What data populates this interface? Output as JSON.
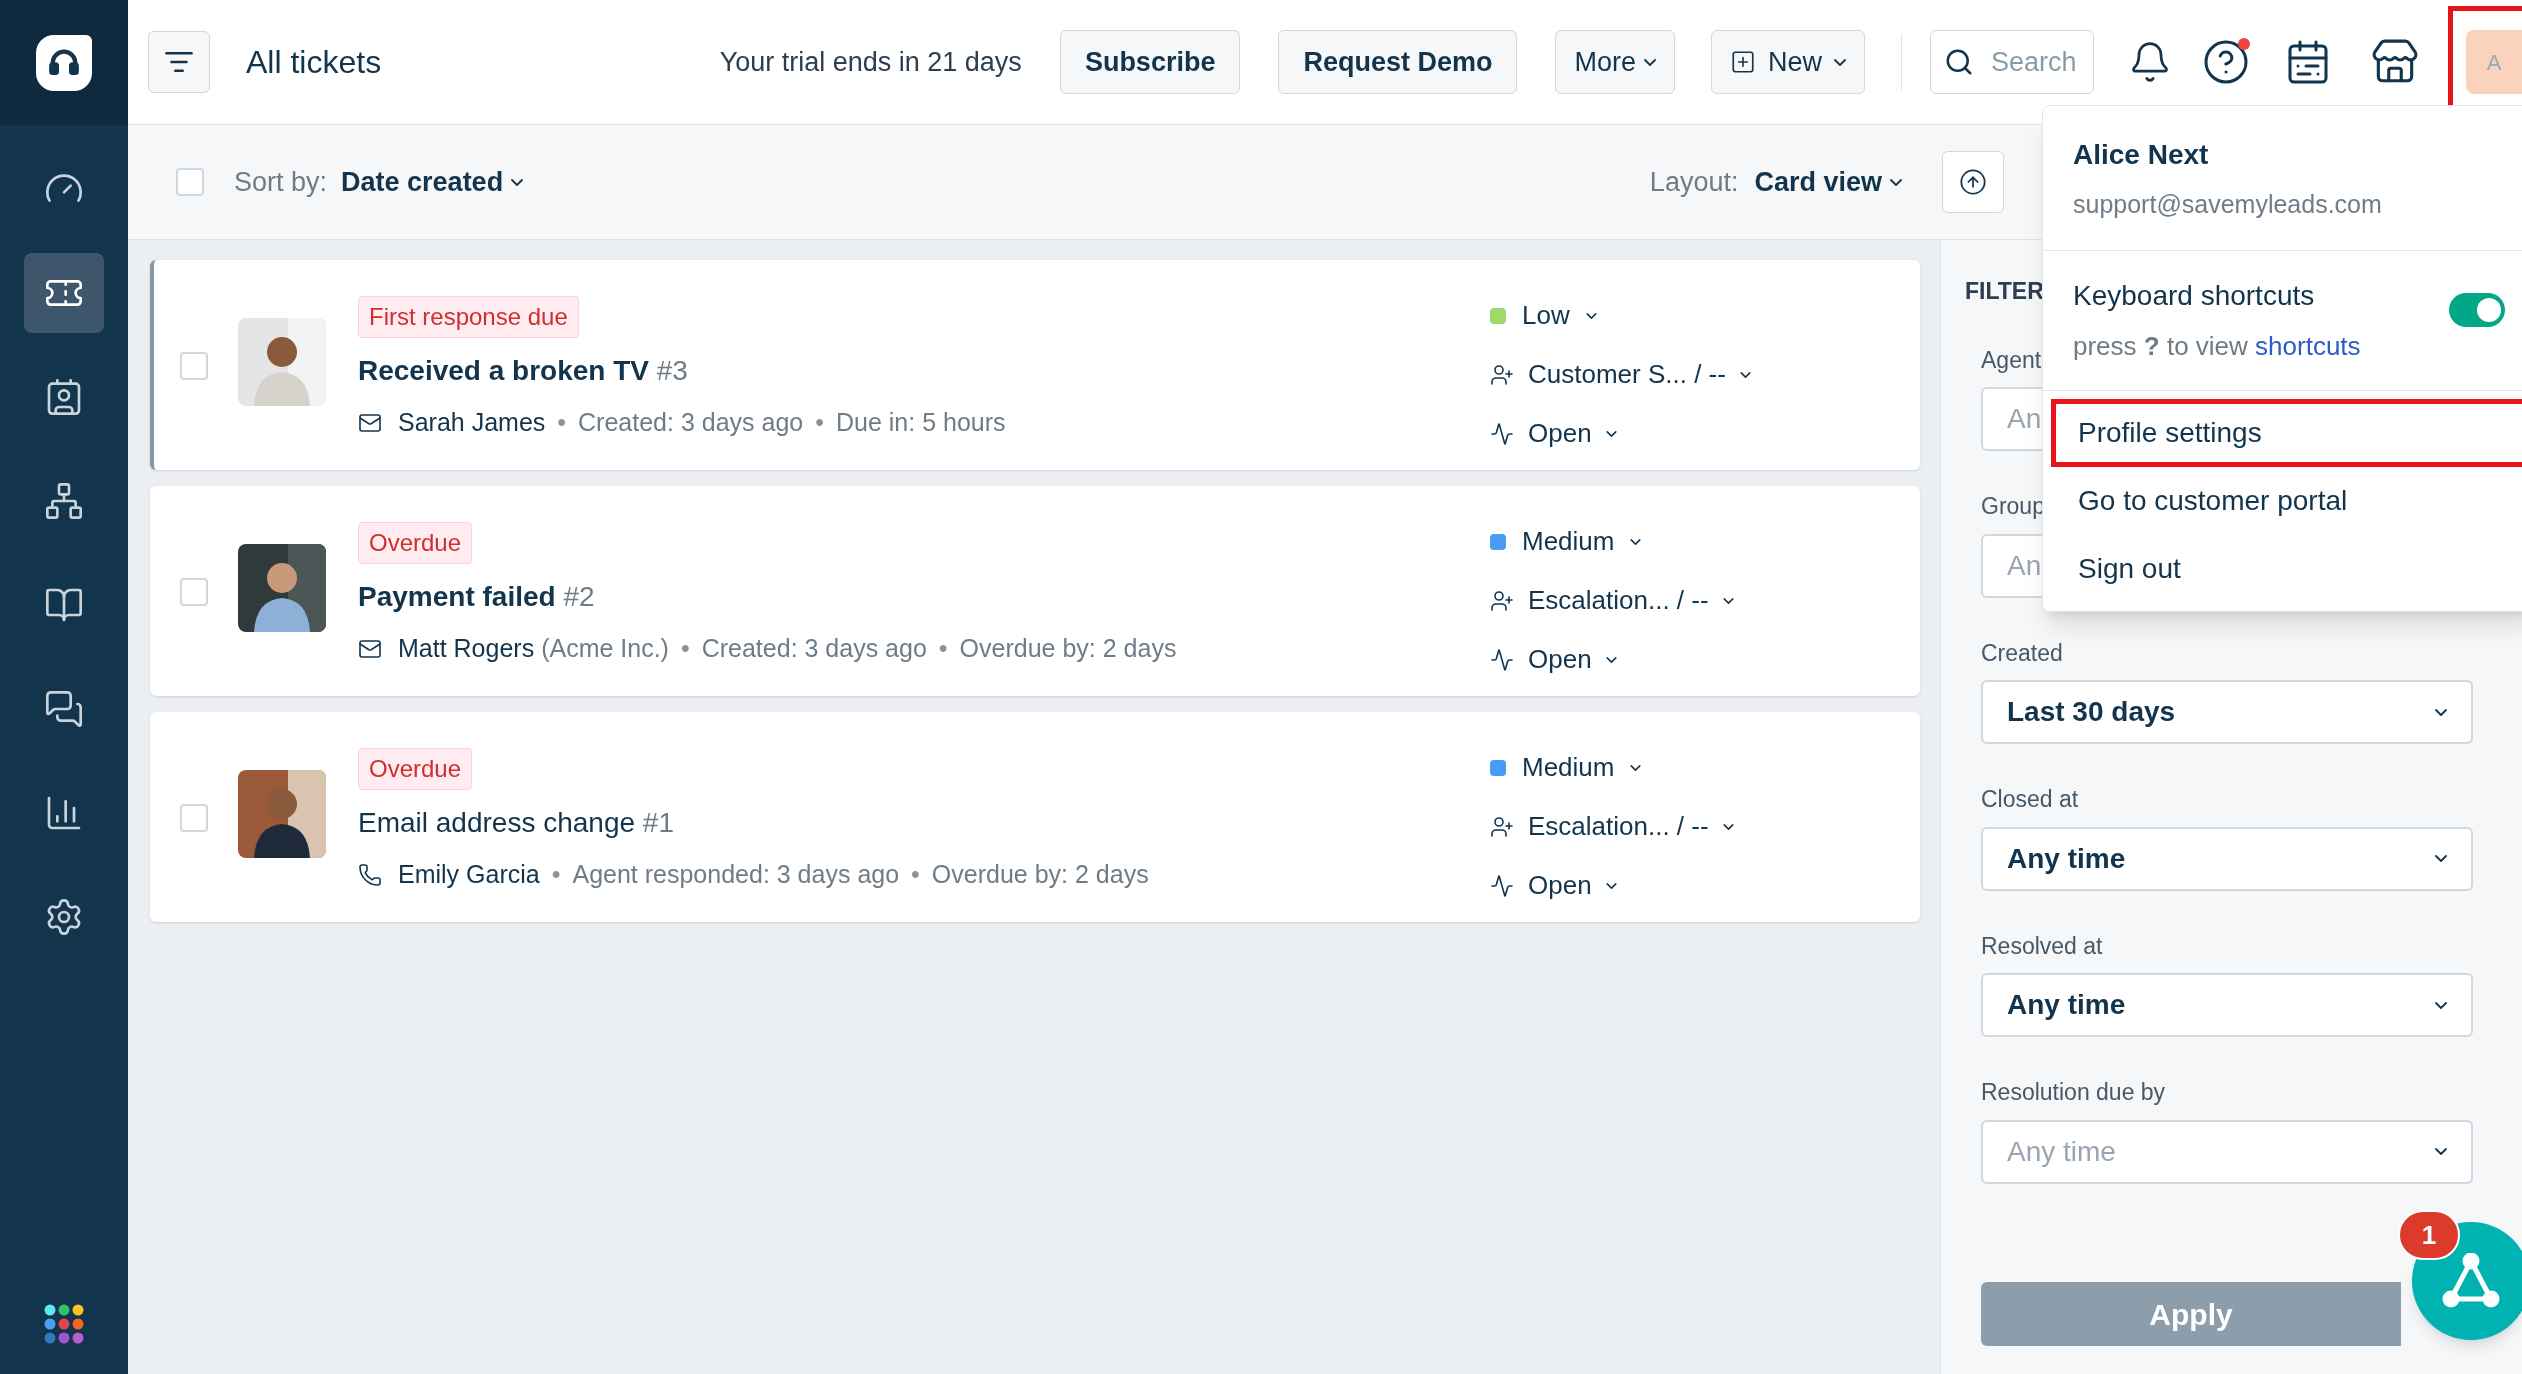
{
  "sidebar": {
    "items": [
      {
        "kind": "dashboard",
        "selected": false
      },
      {
        "kind": "tickets",
        "selected": true
      },
      {
        "kind": "contacts",
        "selected": false
      },
      {
        "kind": "groups",
        "selected": false
      },
      {
        "kind": "knowledge",
        "selected": false
      },
      {
        "kind": "conversations",
        "selected": false
      },
      {
        "kind": "reports",
        "selected": false
      },
      {
        "kind": "settings",
        "selected": false
      }
    ]
  },
  "header": {
    "title": "All tickets",
    "trial_notice": "Your trial ends in 21 days",
    "buttons": [
      "Subscribe",
      "Request Demo"
    ],
    "more": "More",
    "new": "New",
    "search_placeholder": "Search",
    "help_alert": true,
    "avatar": {
      "initial": "A",
      "highlighted": true
    }
  },
  "toolbar": {
    "select_all_checked": false,
    "sort_label": "Sort by:",
    "sort_value": "Date created",
    "layout_label": "Layout:",
    "layout_value": "Card view"
  },
  "tickets": [
    {
      "selected": true,
      "unread": true,
      "tag": "First response due",
      "title": "Received a broken TV",
      "number": "#3",
      "kind": "email",
      "contact": "Sarah James",
      "meta": [
        {
          "sep": "•",
          "text": "Created: 3 days ago"
        },
        {
          "sep": "•",
          "text": "Due in: 5 hours"
        }
      ],
      "priority": "Low",
      "color": "#9fd96b",
      "group": "Customer S... / --",
      "status": "Open"
    },
    {
      "selected": false,
      "unread": true,
      "tag": "Overdue",
      "title": "Payment failed",
      "number": "#2",
      "kind": "email",
      "contact": "Matt Rogers",
      "company": "(Acme Inc.)",
      "meta": [
        {
          "sep": "•",
          "text": "Created: 3 days ago"
        },
        {
          "sep": "•",
          "text": "Overdue by: 2 days"
        }
      ],
      "priority": "Medium",
      "color": "#4a9bf5",
      "group": "Escalation... / --",
      "status": "Open"
    },
    {
      "selected": false,
      "unread": false,
      "tag": "Overdue",
      "title": "Email address change",
      "number": "#1",
      "kind": "phone",
      "contact": "Emily Garcia",
      "meta": [
        {
          "sep": "•",
          "text": "Agent responded: 3 days ago"
        },
        {
          "sep": "•",
          "text": "Overdue by: 2 days"
        }
      ],
      "priority": "Medium",
      "color": "#4a9bf5",
      "group": "Escalation... / --",
      "status": "Open"
    }
  ],
  "filters": {
    "title": "FILTER",
    "fields": [
      {
        "label": "Agent",
        "placeholder": "An",
        "kind": "partial"
      },
      {
        "label": "Group",
        "placeholder": "An",
        "kind": "partial"
      },
      {
        "label": "Created",
        "value": "Last 30 days"
      },
      {
        "label": "Closed at",
        "value": "Any time"
      },
      {
        "label": "Resolved at",
        "value": "Any time"
      },
      {
        "label": "Resolution due by",
        "placeholder": "Any time"
      }
    ],
    "apply": "Apply"
  },
  "profile_menu": {
    "name": "Alice Next",
    "email": "support@savemyleads.com",
    "shortcuts": {
      "label": "Keyboard shortcuts",
      "on": true,
      "hint": "press **?** to view",
      "link": "shortcuts"
    },
    "items": [
      {
        "label": "Profile settings",
        "highlighted": true
      },
      {
        "label": "Go to customer portal",
        "highlighted": false
      },
      {
        "label": "Sign out",
        "highlighted": false
      }
    ]
  },
  "chat_widget": {
    "badge": "1"
  }
}
